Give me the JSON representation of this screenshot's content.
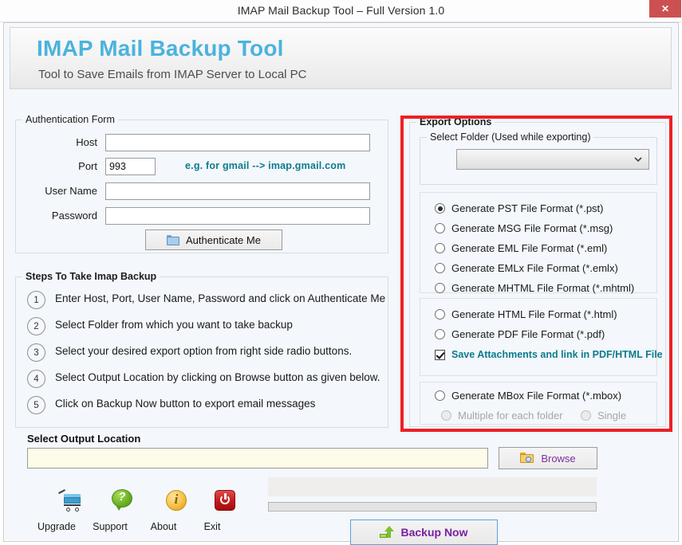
{
  "window": {
    "title": "IMAP Mail Backup Tool – Full Version 1.0",
    "close_label": "✕"
  },
  "banner": {
    "title": "IMAP Mail Backup Tool",
    "subtitle": "Tool to Save Emails from IMAP Server to Local PC",
    "title_color": "#4bb3dd"
  },
  "auth": {
    "legend": "Authentication Form",
    "host_label": "Host",
    "host_value": "",
    "port_label": "Port",
    "port_value": "993",
    "username_label": "User Name",
    "username_value": "",
    "password_label": "Password",
    "password_value": "",
    "hint": "e.g. for gmail -->  imap.gmail.com",
    "hint_color": "#0b7c8c",
    "authenticate_label": "Authenticate Me"
  },
  "steps": {
    "legend": "Steps To Take Imap Backup",
    "items": [
      {
        "num": "1",
        "text": "Enter Host, Port, User Name, Password and click on Authenticate Me"
      },
      {
        "num": "2",
        "text": "Select Folder from which you want to take backup"
      },
      {
        "num": "3",
        "text": "Select your desired export option from right side radio buttons."
      },
      {
        "num": "4",
        "text": "Select Output Location by clicking on Browse button as given below."
      },
      {
        "num": "5",
        "text": "Click on Backup Now button to export email messages"
      }
    ]
  },
  "export": {
    "legend": "Export Options",
    "highlight_color": "#ec2024",
    "folder_legend": "Select Folder (Used while exporting)",
    "folder_selected": "",
    "group1": [
      {
        "label": "Generate PST File Format (*.pst)",
        "checked": true
      },
      {
        "label": "Generate MSG File Format (*.msg)",
        "checked": false
      },
      {
        "label": "Generate EML File Format (*.eml)",
        "checked": false
      },
      {
        "label": "Generate EMLx File Format  (*.emlx)",
        "checked": false
      },
      {
        "label": "Generate MHTML File Format (*.mhtml)",
        "checked": false
      }
    ],
    "group2": [
      {
        "label": "Generate HTML File Format (*.html)",
        "checked": false
      },
      {
        "label": "Generate PDF File Format (*.pdf)",
        "checked": false
      }
    ],
    "attachments_label": "Save Attachments and link in PDF/HTML File",
    "attachments_checked": true,
    "attachments_color": "#0b7c8c",
    "group3": [
      {
        "label": "Generate MBox File Format (*.mbox)",
        "checked": false
      }
    ],
    "mbox_sub": [
      {
        "label": "Multiple for each folder",
        "checked": false,
        "disabled": true
      },
      {
        "label": "Single",
        "checked": false,
        "disabled": true
      }
    ]
  },
  "output": {
    "label": "Select  Output Location",
    "path_value": "",
    "browse_label": "Browse",
    "browse_color": "#7b2fa0"
  },
  "progress": {
    "status_text": "",
    "percent": 0
  },
  "actions": {
    "backup_label": "Backup Now",
    "backup_color": "#7b1fa2"
  },
  "toolbar": [
    {
      "label": "Upgrade",
      "icon": "cart-icon"
    },
    {
      "label": "Support",
      "icon": "question-bubble-icon"
    },
    {
      "label": "About",
      "icon": "info-icon"
    },
    {
      "label": "Exit",
      "icon": "power-icon"
    }
  ]
}
